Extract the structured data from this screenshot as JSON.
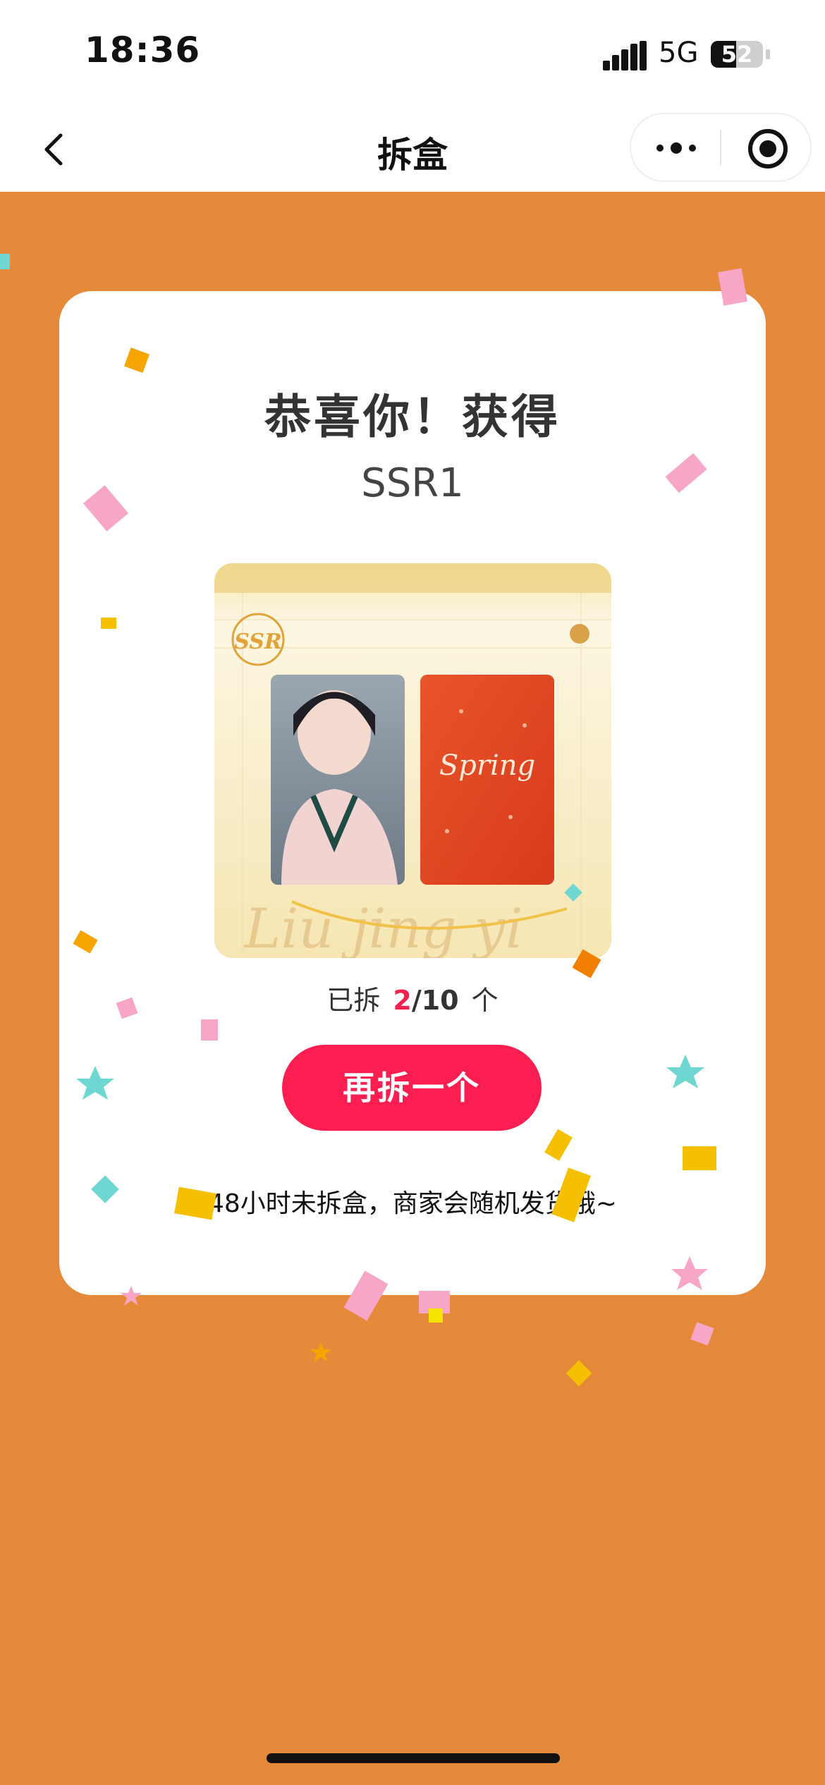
{
  "status_bar": {
    "time": "18:36",
    "network": "5G",
    "battery": "52"
  },
  "nav": {
    "title": "拆盒",
    "back_icon": "chevron-left-icon",
    "more_icon": "more-dots-icon",
    "close_icon": "target-icon"
  },
  "card": {
    "headline": "恭喜你！获得",
    "prize_name": "SSR1",
    "prize_image": {
      "badge_text": "SSR",
      "card_text": "Spring",
      "script_text": "Liu jing yi"
    },
    "progress": {
      "label": "已拆",
      "current": "2",
      "total": "/10",
      "unit": "个"
    },
    "again_button": "再拆一个",
    "notice": "48小时未拆盒，商家会随机发货哦~"
  },
  "colors": {
    "background": "#E58A3A",
    "accent": "#FC1E50",
    "card": "#FFFFFF"
  }
}
